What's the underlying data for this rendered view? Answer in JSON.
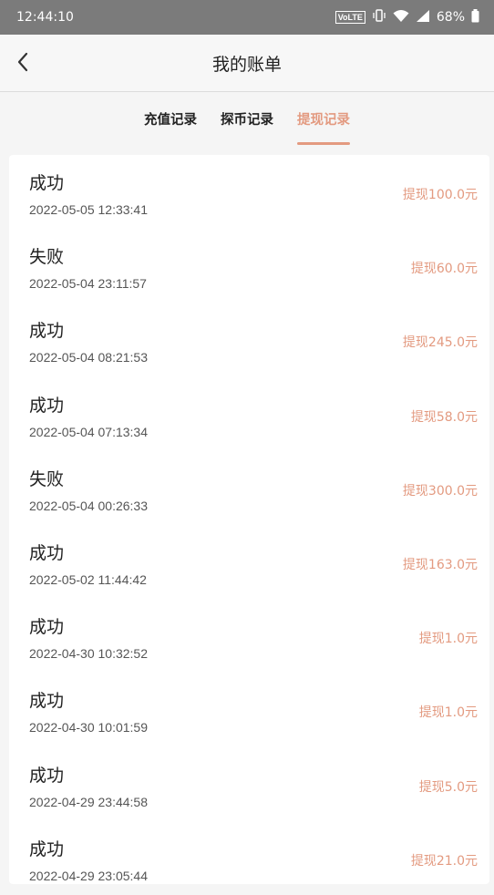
{
  "status_bar": {
    "time": "12:44:10",
    "volte": "VoLTE",
    "battery": "68%",
    "icons": [
      "vibrate-icon",
      "wifi-icon",
      "signal-icon",
      "battery-icon"
    ]
  },
  "navbar": {
    "title": "我的账单",
    "back_icon": "chevron-left-icon"
  },
  "tabs": [
    {
      "label": "充值记录",
      "active": false
    },
    {
      "label": "探币记录",
      "active": false
    },
    {
      "label": "提现记录",
      "active": true
    }
  ],
  "colors": {
    "accent": "#e39a80",
    "status_bar": "#7b7b7b"
  },
  "records": [
    {
      "status": "成功",
      "time": "2022-05-05 12:33:41",
      "amount": "提现100.0元"
    },
    {
      "status": "失败",
      "time": "2022-05-04 23:11:57",
      "amount": "提现60.0元"
    },
    {
      "status": "成功",
      "time": "2022-05-04 08:21:53",
      "amount": "提现245.0元"
    },
    {
      "status": "成功",
      "time": "2022-05-04 07:13:34",
      "amount": "提现58.0元"
    },
    {
      "status": "失败",
      "time": "2022-05-04 00:26:33",
      "amount": "提现300.0元"
    },
    {
      "status": "成功",
      "time": "2022-05-02 11:44:42",
      "amount": "提现163.0元"
    },
    {
      "status": "成功",
      "time": "2022-04-30 10:32:52",
      "amount": "提现1.0元"
    },
    {
      "status": "成功",
      "time": "2022-04-30 10:01:59",
      "amount": "提现1.0元"
    },
    {
      "status": "成功",
      "time": "2022-04-29 23:44:58",
      "amount": "提现5.0元"
    },
    {
      "status": "成功",
      "time": "2022-04-29 23:05:44",
      "amount": "提现21.0元"
    }
  ]
}
